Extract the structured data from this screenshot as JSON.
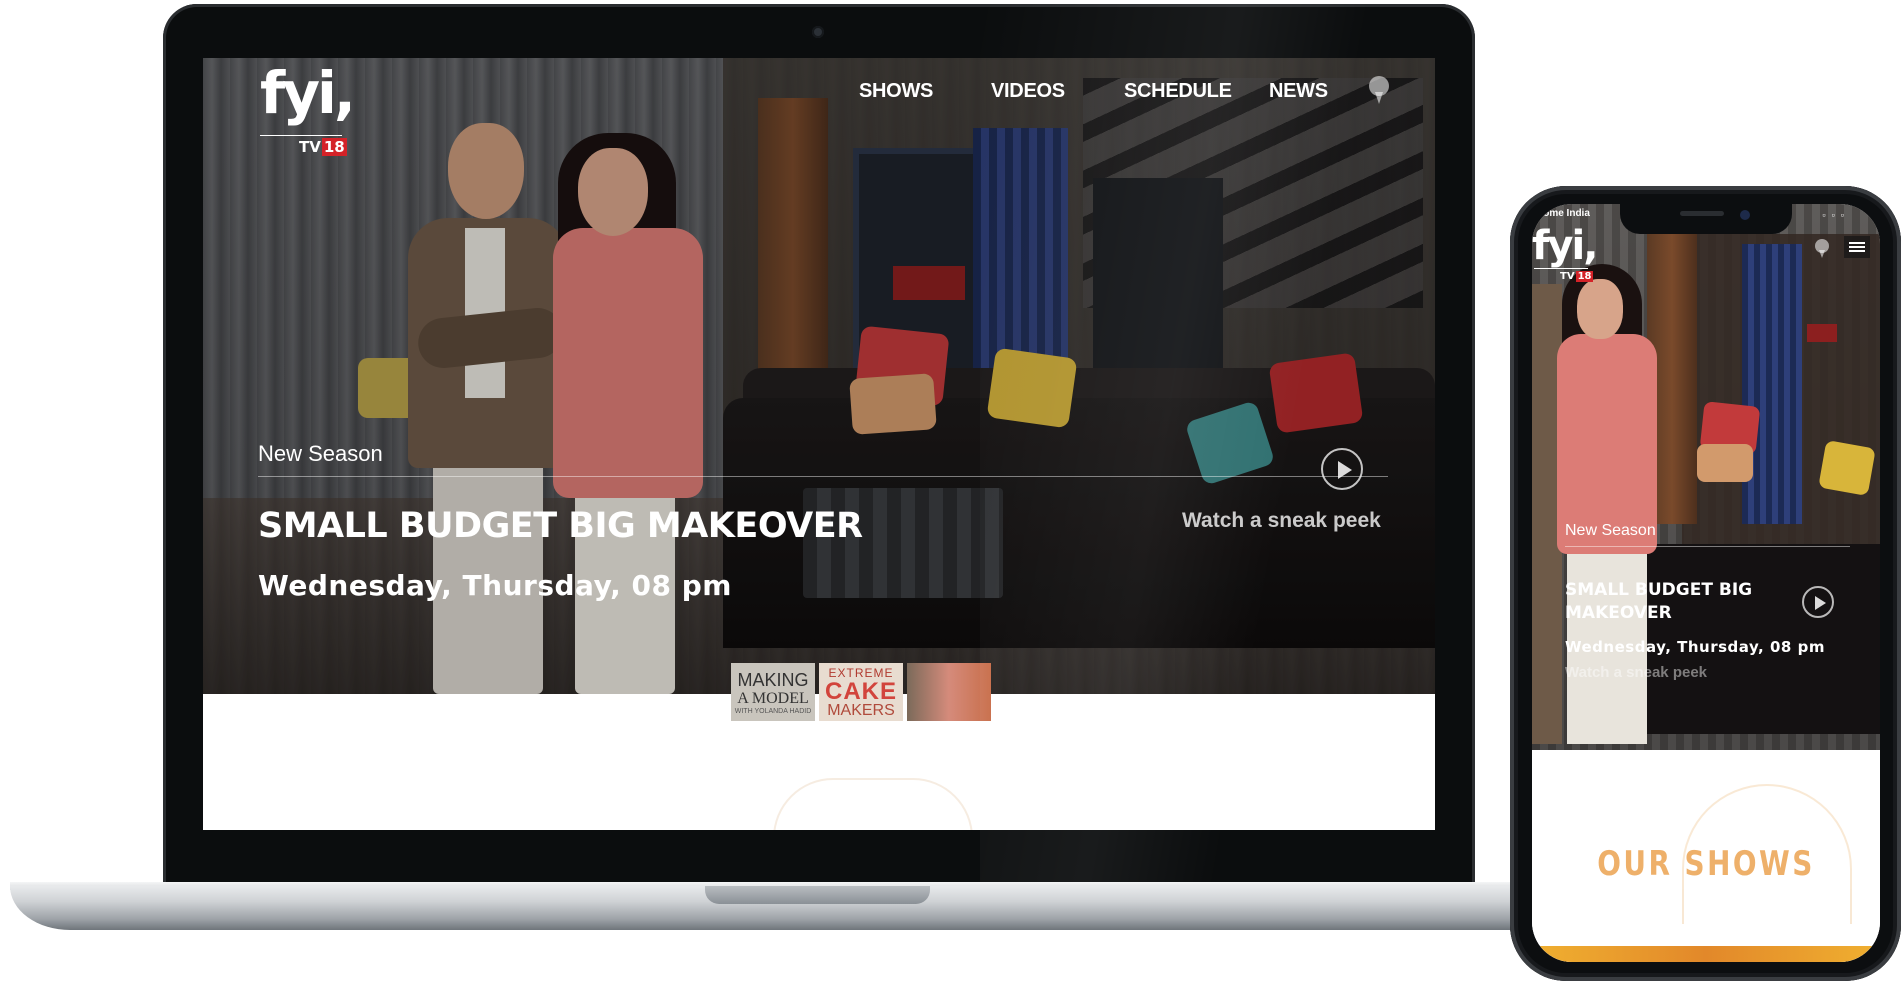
{
  "laptop": {
    "logo": {
      "wordmark": "fyi,",
      "sub": "TV",
      "sub_badge": "18"
    },
    "nav": {
      "items": [
        "SHOWS",
        "VIDEOS",
        "SCHEDULE",
        "NEWS"
      ]
    },
    "hero": {
      "kicker": "New Season",
      "title": "SMALL BUDGET BIG MAKEOVER",
      "schedule": "Wednesday, Thursday, 08 pm",
      "cta": "Watch a sneak peek"
    },
    "thumbnails": [
      {
        "lines": [
          "MAKING",
          "A MODEL",
          "WITH YOLANDA HADID"
        ]
      },
      {
        "lines": [
          "EXTREME",
          "CAKE",
          "MAKERS"
        ]
      },
      {
        "lines": []
      }
    ]
  },
  "phone": {
    "status": "Come India",
    "logo": {
      "wordmark": "fyi,",
      "sub": "TV",
      "sub_badge": "18"
    },
    "hero": {
      "kicker": "New Season",
      "title": "SMALL BUDGET BIG MAKEOVER",
      "schedule": "Wednesday, Thursday, 08 pm",
      "cta": "Watch a sneak peek"
    },
    "section_title": "OUR SHOWS"
  },
  "colors": {
    "accent_red": "#d42228",
    "section_orange": "#eeb06a"
  },
  "icons": [
    "search-icon",
    "play-icon",
    "menu-icon"
  ]
}
